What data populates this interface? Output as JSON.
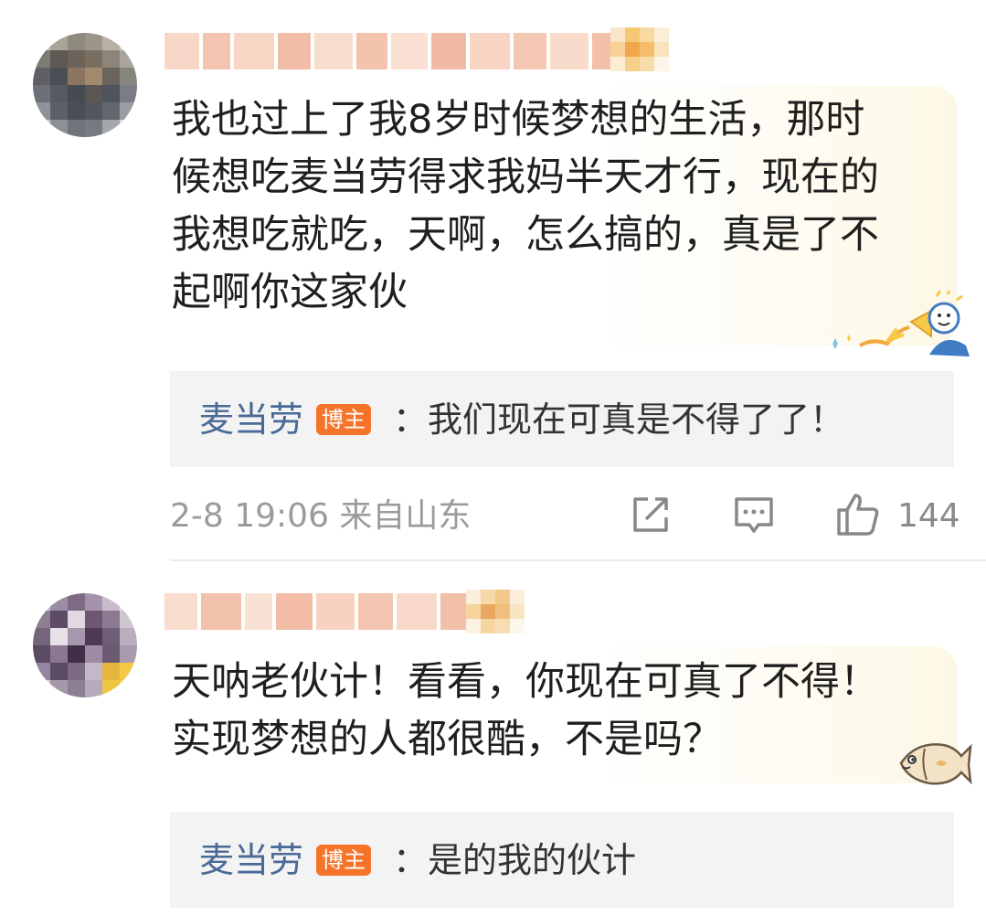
{
  "comments": [
    {
      "text": "我也过上了我8岁时候梦想的生活，那时候想吃麦当劳得求我妈半天才行，现在的我想吃就吃，天啊，怎么搞的，真是了不起啊你这家伙",
      "lines": [
        "我也过上了我8岁时候梦想的生活，那时",
        "候想吃麦当劳得求我妈半天才行，现在的",
        "我想吃就吃，天啊，怎么搞的，真是了不",
        "起啊你这家伙"
      ],
      "reply": {
        "author": "麦当劳",
        "badge": "博主",
        "text": "：我们现在可真是不得了了！"
      },
      "meta": "2-8 19:06  来自山东",
      "like_count": "144",
      "sticker": "megaphone-character-icon"
    },
    {
      "text": "天呐老伙计！看看，你现在可真了不得！实现梦想的人都很酷，不是吗？",
      "lines": [
        "天呐老伙计！看看，你现在可真了不得！",
        "实现梦想的人都很酷，不是吗？"
      ],
      "reply": {
        "author": "麦当劳",
        "badge": "博主",
        "text": "：是的我的伙计"
      },
      "sticker": "fish-icon"
    }
  ],
  "icons": {
    "share": "share-icon",
    "comment": "comment-icon",
    "like": "thumbs-up-icon"
  },
  "colors": {
    "author_link": "#4a6a96",
    "badge": "#f5742a",
    "meta": "#9b9b9b",
    "reply_bg": "#f3f3f3"
  }
}
